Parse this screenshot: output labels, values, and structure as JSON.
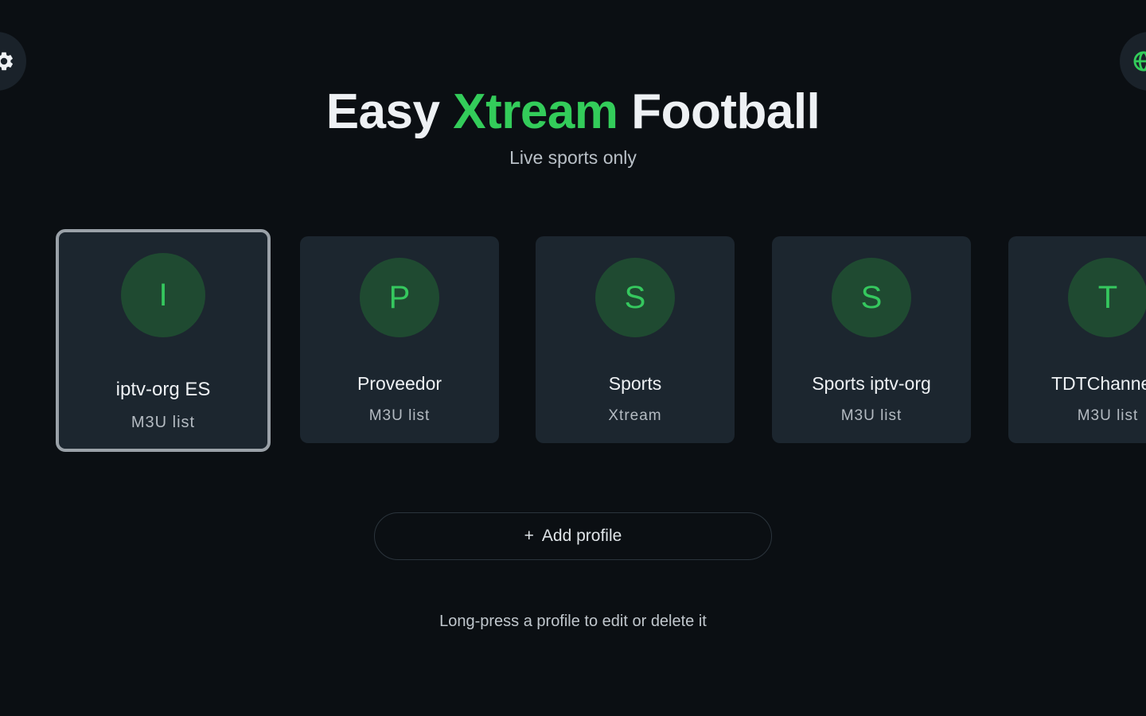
{
  "header": {
    "title_part1": "Easy",
    "title_accent": "Xtream",
    "title_part2": "Football",
    "subtitle": "Live sports only"
  },
  "icons": {
    "settings": "gear-icon",
    "language": "globe-icon"
  },
  "colors": {
    "background": "#0b0f13",
    "accent": "#33cc5a",
    "card": "#1c262f",
    "avatar_bg": "#1f4a31"
  },
  "profiles": [
    {
      "initial": "I",
      "name": "iptv-org ES",
      "type": "M3U list"
    },
    {
      "initial": "P",
      "name": "Proveedor",
      "type": "M3U list"
    },
    {
      "initial": "S",
      "name": "Sports",
      "type": "Xtream"
    },
    {
      "initial": "S",
      "name": "Sports iptv-org",
      "type": "M3U list"
    },
    {
      "initial": "T",
      "name": "TDTChannels",
      "type": "M3U list"
    }
  ],
  "actions": {
    "add_profile_icon": "+",
    "add_profile_label": "Add profile"
  },
  "hint": "Long-press a profile to edit or delete it"
}
